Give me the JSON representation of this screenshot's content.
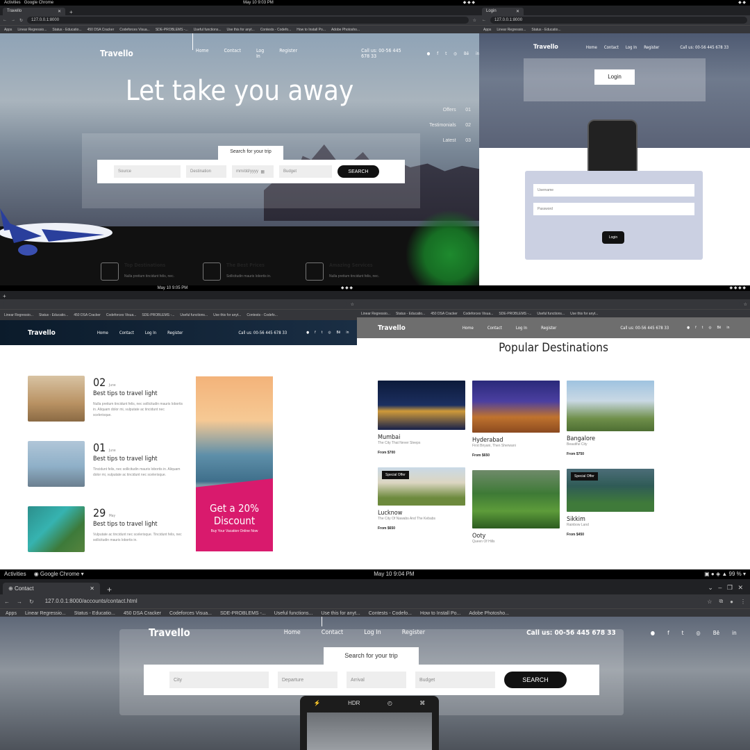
{
  "gnome": {
    "activities": "Activities",
    "app": "Google Chrome",
    "time1": "May 10  9:03 PM",
    "time2": "May 10  9:05 PM",
    "time3": "May 10  9:04 PM",
    "battery": "99 %"
  },
  "browser": {
    "tab_title": "Travello",
    "tab_contact": "Contact",
    "url_home": "127.0.0.1:8000",
    "url_contact": "127.0.0.1:8000/accounts/contact.html"
  },
  "bookmarks": [
    "Apps",
    "Linear Regressio...",
    "Status - Educatio...",
    "450 DSA Cracker",
    "Codeforces Visua...",
    "SDE-PROBLEMS -...",
    "Useful functions...",
    "Use this for anyt...",
    "Contests - Codefo...",
    "How to Install Po...",
    "Adobe Photosho..."
  ],
  "site": {
    "brand": "Travello",
    "nav": [
      "Home",
      "Contact",
      "Log In",
      "Register"
    ],
    "phone": "Call us: 00-56 445 678 33",
    "socials": [
      "pinterest-icon",
      "facebook-icon",
      "twitter-icon",
      "dribbble-icon",
      "behance-icon",
      "linkedin-icon"
    ]
  },
  "hero": {
    "title": "Let take you away",
    "side": [
      {
        "label": "Offers",
        "num": "01"
      },
      {
        "label": "Testimonials",
        "num": "02"
      },
      {
        "label": "Latest",
        "num": "03"
      }
    ]
  },
  "search": {
    "tab": "Search for your trip",
    "fields": [
      "Source",
      "Destination",
      "mm/dd/yyyy",
      "Budget"
    ],
    "button": "SEARCH"
  },
  "features": [
    {
      "title": "Top Destinations",
      "text": "Nulla pretium tincidunt felis, nec."
    },
    {
      "title": "The Best Prices",
      "text": "Sollicitudin mauris lobortis in."
    },
    {
      "title": "Amazing Services",
      "text": "Nulla pretium tincidunt felis, nec."
    }
  ],
  "login": {
    "heading": "Login",
    "fields": [
      "Username",
      "Password"
    ],
    "button": "Login"
  },
  "posts": [
    {
      "day": "02",
      "month": "June",
      "title": "Best tips to travel light",
      "meta": "Lorem ipsum dolor",
      "text": "Nulla pretium tincidunt felis, nec sollicitudin mauris lobortis in. Aliquam dolor mi, vulputate ac tincidunt nec scelerisque."
    },
    {
      "day": "01",
      "month": "June",
      "title": "Best tips to travel light",
      "meta": "Lorem ipsum dolor",
      "text": "Tincidunt felis, nec sollicitudin mauris lobortis in. Aliquam dolor mi, vulputate ac tincidunt nec scelerisque."
    },
    {
      "day": "29",
      "month": "May",
      "title": "Best tips to travel light",
      "meta": "Lorem ipsum dolor",
      "text": "Vulputate ac tincidunt nec scelerisque. Tincidunt felis, nec sollicitudin mauris lobortis in."
    }
  ],
  "promo": {
    "line1": "Get a 20%",
    "line2": "Discount",
    "line3": "Buy Your Vacation Online Now"
  },
  "popular": {
    "title": "Popular Destinations",
    "cards": [
      {
        "name": "Mumbai",
        "sub": "The City That Never Sleeps",
        "price": "From $700",
        "offer": ""
      },
      {
        "name": "Hyderabad",
        "sub": "First Biryani, Then Sherwani",
        "price": "From $650",
        "offer": ""
      },
      {
        "name": "Bangalore",
        "sub": "Beautiful City",
        "price": "From $750",
        "offer": ""
      },
      {
        "name": "Lucknow",
        "sub": "The City Of Nawabs And The Kebabs",
        "price": "From $650",
        "offer": "Special Offer"
      },
      {
        "name": "Ooty",
        "sub": "Queen Of Hills",
        "price": "",
        "offer": ""
      },
      {
        "name": "Sikkim",
        "sub": "Rainbow Land",
        "price": "From $450",
        "offer": "Special Offer"
      }
    ]
  },
  "contact_search": {
    "tab": "Search for your trip",
    "fields": [
      "City",
      "Departure",
      "Arrival",
      "Budget"
    ],
    "button": "SEARCH"
  },
  "camera": {
    "hdr": "HDR"
  },
  "colors": {
    "dark_nav": "#0b1b2b",
    "pink": "#d91a6d",
    "card_bg": "#cbd0e2",
    "gray_nav": "#6e6e6e"
  }
}
